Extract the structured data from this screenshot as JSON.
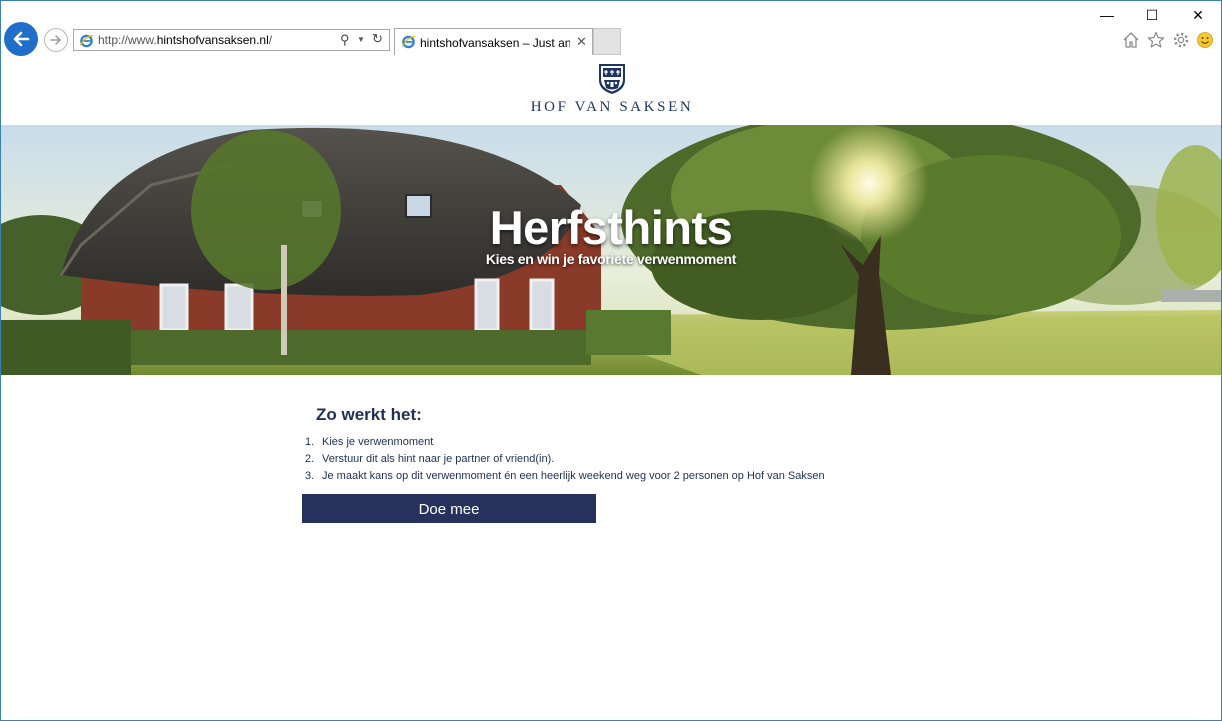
{
  "browser": {
    "url_prefix": "http://www.",
    "url_domain": "hintshofvansaksen.nl",
    "url_suffix": "/",
    "tab_title": "hintshofvansaksen – Just an...",
    "tab_close": "✕",
    "window_controls": {
      "minimize": "—",
      "maximize": "☐",
      "close": "✕"
    },
    "toolbar_icons": [
      "home-icon",
      "favorites-star-icon",
      "settings-gear-icon",
      "feedback-smiley-icon"
    ],
    "accent_color": "#1f6ec9"
  },
  "logo": {
    "brand": "HOF VAN SAKSEN"
  },
  "hero": {
    "title": "Herfsthints",
    "subtitle": "Kies en win je favoriete verwenmoment"
  },
  "howto": {
    "title": "Zo werkt het:",
    "steps": [
      {
        "num": "1.",
        "text": "Kies je verwenmoment"
      },
      {
        "num": "2.",
        "text": "Verstuur dit als hint naar je partner of vriend(in)."
      },
      {
        "num": "3.",
        "text": "Je maakt kans op dit verwenmoment én een heerlijk weekend weg voor 2 personen op Hof van Saksen"
      }
    ]
  },
  "cta": {
    "label": "Doe mee",
    "color": "#26325c"
  },
  "colors": {
    "navy": "#1f2f55"
  }
}
